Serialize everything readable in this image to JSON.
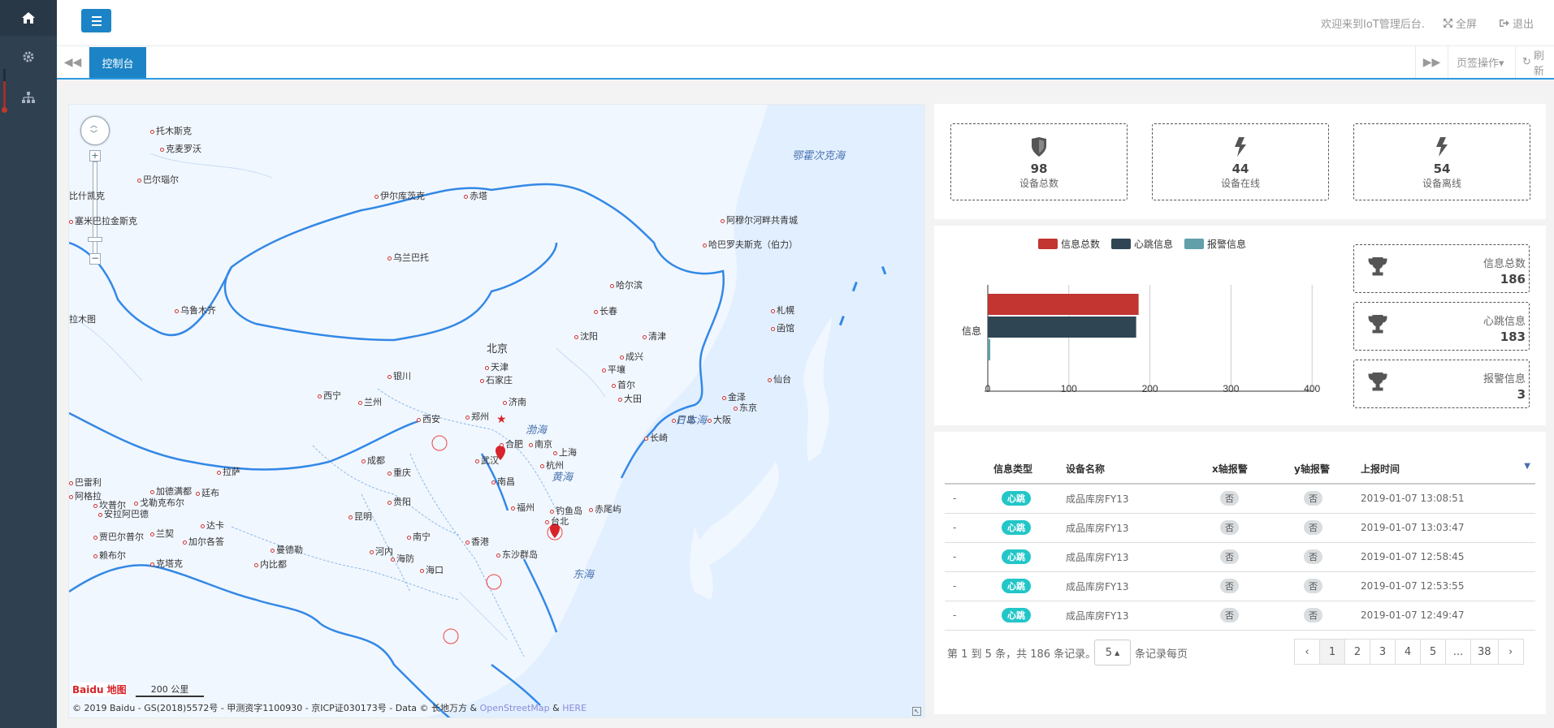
{
  "sidebar": {
    "items": [
      {
        "icon": "home-icon"
      },
      {
        "icon": "gear-icon"
      },
      {
        "icon": "sitemap-icon"
      }
    ]
  },
  "header": {
    "welcome": "欢迎来到IoT管理后台.",
    "fullscreen": "全屏",
    "logout": "退出"
  },
  "tabs": {
    "active": "控制台",
    "ops": "页签操作▾",
    "refresh": "刷新"
  },
  "map": {
    "labels": [
      {
        "t": "托木斯克"
      },
      {
        "t": "克麦罗沃"
      },
      {
        "t": "巴尔瑙尔"
      },
      {
        "t": "伊尔库茨克"
      },
      {
        "t": "赤塔"
      },
      {
        "t": "塞米巴拉金斯克"
      },
      {
        "t": "乌兰巴托"
      },
      {
        "t": "阿穆尔河畔共青城"
      },
      {
        "t": "哈巴罗夫斯克（伯力）"
      },
      {
        "t": "乌鲁木齐"
      },
      {
        "t": "哈尔滨"
      },
      {
        "t": "长春"
      },
      {
        "t": "沈阳"
      },
      {
        "t": "清津"
      },
      {
        "t": "札幌"
      },
      {
        "t": "函馆"
      },
      {
        "t": "北京"
      },
      {
        "t": "天津"
      },
      {
        "t": "石家庄"
      },
      {
        "t": "银川"
      },
      {
        "t": "成兴"
      },
      {
        "t": "平壤"
      },
      {
        "t": "首尔"
      },
      {
        "t": "大田"
      },
      {
        "t": "仙台"
      },
      {
        "t": "西宁"
      },
      {
        "t": "兰州"
      },
      {
        "t": "济南"
      },
      {
        "t": "郑州"
      },
      {
        "t": "西安"
      },
      {
        "t": "金泽"
      },
      {
        "t": "东京"
      },
      {
        "t": "广岛"
      },
      {
        "t": "大阪"
      },
      {
        "t": "长崎"
      },
      {
        "t": "合肥"
      },
      {
        "t": "南京"
      },
      {
        "t": "上海"
      },
      {
        "t": "杭州"
      },
      {
        "t": "成都"
      },
      {
        "t": "武汉"
      },
      {
        "t": "重庆"
      },
      {
        "t": "拉萨"
      },
      {
        "t": "南昌"
      },
      {
        "t": "贵阳"
      },
      {
        "t": "福州"
      },
      {
        "t": "钓鱼岛"
      },
      {
        "t": "赤尾屿"
      },
      {
        "t": "台北"
      },
      {
        "t": "昆明"
      },
      {
        "t": "南宁"
      },
      {
        "t": "香港"
      },
      {
        "t": "河内"
      },
      {
        "t": "海防"
      },
      {
        "t": "东沙群岛"
      },
      {
        "t": "海口"
      },
      {
        "t": "巴雷利"
      },
      {
        "t": "加德满都"
      },
      {
        "t": "廷布"
      },
      {
        "t": "阿格拉"
      },
      {
        "t": "坎普尔"
      },
      {
        "t": "戈勒克布尔"
      },
      {
        "t": "安拉阿巴德"
      },
      {
        "t": "达卡"
      },
      {
        "t": "贾巴尔普尔"
      },
      {
        "t": "兰契"
      },
      {
        "t": "加尔各答"
      },
      {
        "t": "曼德勒"
      },
      {
        "t": "赖布尔"
      },
      {
        "t": "克塔克"
      },
      {
        "t": "内比都"
      },
      {
        "t": "拉木图"
      },
      {
        "t": "比什凯克"
      }
    ],
    "seas": [
      "鄂霍次克海",
      "日本海",
      "渤海",
      "黄海",
      "东海"
    ],
    "copyright": "© 2019 Baidu - GS(2018)5572号 - 甲测资字1100930 - 京ICP证030173号 - Data © 长地万方 & ",
    "osm": "OpenStreetMap",
    "amp": " & ",
    "here": "HERE",
    "scale": "200 公里",
    "logo": "Baidu 地图"
  },
  "stats": [
    {
      "value": "98",
      "label": "设备总数",
      "icon": "shield-icon"
    },
    {
      "value": "44",
      "label": "设备在线",
      "icon": "bolt-icon"
    },
    {
      "value": "54",
      "label": "设备离线",
      "icon": "bolt-icon"
    }
  ],
  "chart_data": {
    "type": "bar",
    "orientation": "horizontal",
    "categories": [
      "信息"
    ],
    "series": [
      {
        "name": "信息总数",
        "values": [
          186
        ],
        "color": "#c23531"
      },
      {
        "name": "心跳信息",
        "values": [
          183
        ],
        "color": "#2f4554"
      },
      {
        "name": "报警信息",
        "values": [
          3
        ],
        "color": "#61a0a8"
      }
    ],
    "xlim": [
      0,
      400
    ],
    "xticks": [
      "0",
      "100",
      "200",
      "300",
      "400"
    ],
    "legend": "top",
    "grid": true
  },
  "info": [
    {
      "label": "信息总数",
      "value": "186",
      "icon": "trophy-icon"
    },
    {
      "label": "心跳信息",
      "value": "183",
      "icon": "trophy-icon"
    },
    {
      "label": "报警信息",
      "value": "3",
      "icon": "trophy-icon"
    }
  ],
  "table": {
    "headers": [
      "",
      "信息类型",
      "设备名称",
      "x轴报警",
      "y轴报警",
      "上报时间"
    ],
    "rows": [
      {
        "dash": "-",
        "type": "心跳",
        "name": "成品库房FY13",
        "x": "否",
        "y": "否",
        "time": "2019-01-07 13:08:51"
      },
      {
        "dash": "-",
        "type": "心跳",
        "name": "成品库房FY13",
        "x": "否",
        "y": "否",
        "time": "2019-01-07 13:03:47"
      },
      {
        "dash": "-",
        "type": "心跳",
        "name": "成品库房FY13",
        "x": "否",
        "y": "否",
        "time": "2019-01-07 12:58:45"
      },
      {
        "dash": "-",
        "type": "心跳",
        "name": "成品库房FY13",
        "x": "否",
        "y": "否",
        "time": "2019-01-07 12:53:55"
      },
      {
        "dash": "-",
        "type": "心跳",
        "name": "成品库房FY13",
        "x": "否",
        "y": "否",
        "time": "2019-01-07 12:49:47"
      }
    ],
    "summary": "第 1 到 5 条，共 186 条记录。",
    "page_size": "5",
    "per_page": "条记录每页",
    "pages": [
      "‹",
      "1",
      "2",
      "3",
      "4",
      "5",
      "...",
      "38",
      "›"
    ]
  }
}
